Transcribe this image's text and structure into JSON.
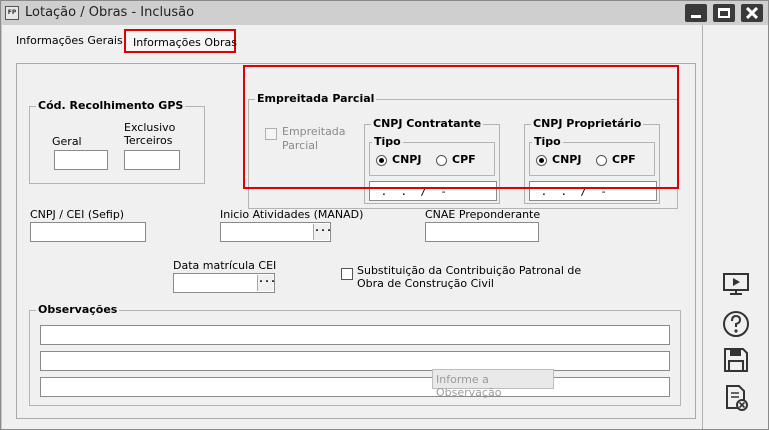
{
  "window": {
    "title": "Lotação / Obras - Inclusão",
    "app_icon": "FP"
  },
  "tabs": {
    "general": "Informações Gerais",
    "obras": "Informações Obras"
  },
  "gps": {
    "title": "Cód. Recolhimento GPS",
    "geral_label": "Geral",
    "terceiros_label_1": "Exclusivo",
    "terceiros_label_2": "Terceiros",
    "geral_value": "",
    "terceiros_value": ""
  },
  "empreitada": {
    "title": "Empreitada Parcial",
    "checkbox_label_1": "Empreitada",
    "checkbox_label_2": "Parcial",
    "checked": false,
    "contratante": {
      "title": "CNPJ Contratante",
      "tipo": "Tipo",
      "opt_cnpj": "CNPJ",
      "opt_cpf": "CPF",
      "selected": "CNPJ",
      "value": " .  .  /  -"
    },
    "proprietario": {
      "title": "CNPJ Proprietário",
      "tipo": "Tipo",
      "opt_cnpj": "CNPJ",
      "opt_cpf": "CPF",
      "selected": "CNPJ",
      "value": " .  .  /  -"
    }
  },
  "fields": {
    "cnpj_cei_label": "CNPJ / CEI (Sefip)",
    "cnpj_cei_value": "",
    "inicio_label": "Inicio Atividades (MANAD)",
    "inicio_value": "",
    "cnae_label": "CNAE Preponderante",
    "cnae_value": "",
    "data_cei_label": "Data matrícula CEI",
    "data_cei_value": "",
    "substituicao_label_1": "Substituição da Contribuição Patronal de",
    "substituicao_label_2": "Obra de Construção Civil",
    "substituicao_checked": false,
    "ellipsis": "..."
  },
  "observacoes": {
    "title": "Observações",
    "lines": [
      "",
      "",
      ""
    ],
    "tooltip": "Informe a Observação"
  },
  "sidebar": {
    "icons": [
      "presentation-icon",
      "help-icon",
      "save-icon",
      "cancel-document-icon"
    ]
  },
  "colors": {
    "highlight": "#e00000",
    "window_bg": "#f0f0f0",
    "titlebar_bg": "#cfcfcf",
    "window_button": "#3a3a3a"
  }
}
